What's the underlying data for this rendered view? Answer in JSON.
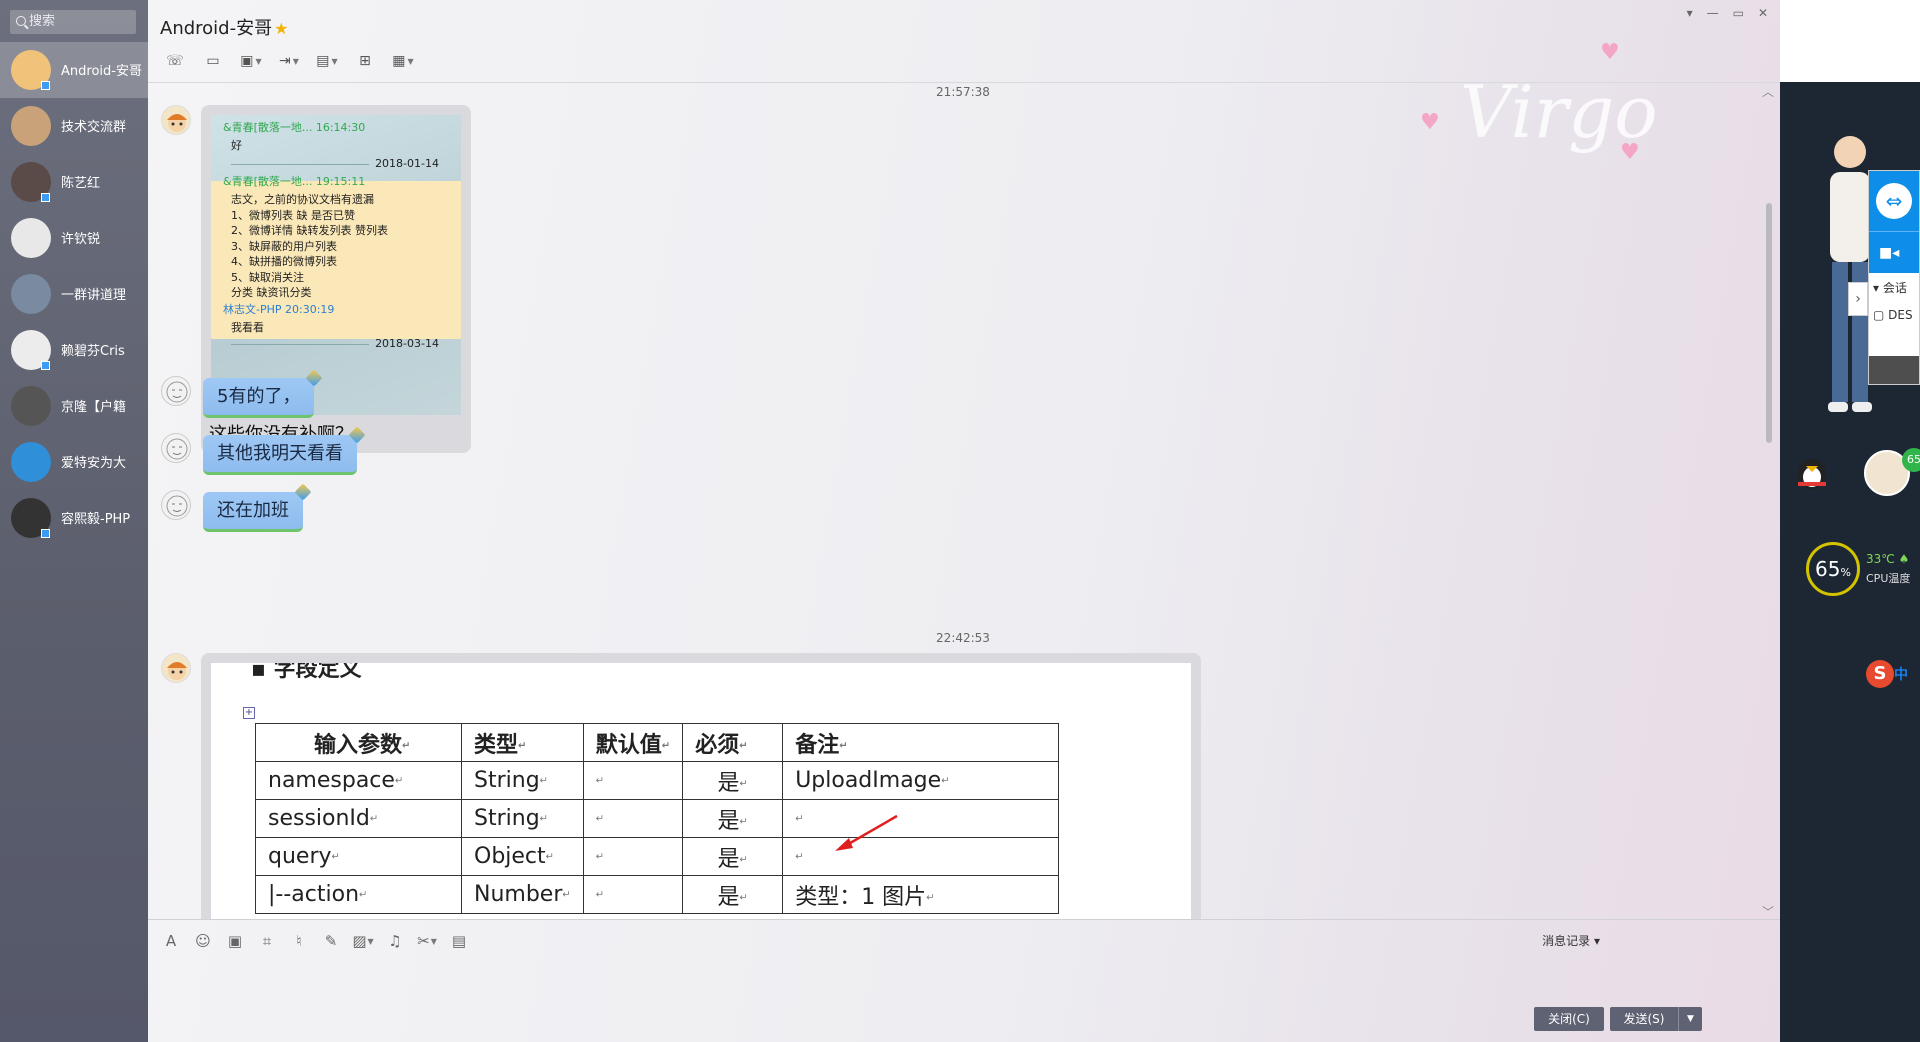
{
  "search": {
    "placeholder": "搜索"
  },
  "contacts": [
    {
      "name": "Android-安哥",
      "active": true
    },
    {
      "name": "技术交流群",
      "active": false
    },
    {
      "name": "陈艺红",
      "active": false
    },
    {
      "name": "许钦锐",
      "active": false
    },
    {
      "name": "一群讲道理",
      "active": false
    },
    {
      "name": "赖碧芬Cris",
      "active": false
    },
    {
      "name": "京隆【户籍",
      "active": false
    },
    {
      "name": "爱特安为大",
      "active": false
    },
    {
      "name": "容熙毅-PHP",
      "active": false
    }
  ],
  "header": {
    "title": "Android-安哥",
    "toolbar_icons": [
      "phone-icon",
      "video-icon",
      "screen-share-icon",
      "file-transfer-icon",
      "remote-desktop-icon",
      "new-chat-icon",
      "apps-icon"
    ]
  },
  "chat": {
    "timestamp_1": "21:57:38",
    "quote": {
      "lines": [
        {
          "text": "&青春[散落一地... 16:14:30",
          "kind": "sender"
        },
        {
          "text": "好",
          "kind": "body"
        },
        {
          "text": "2018-01-14",
          "kind": "date"
        },
        {
          "text": "&青春[散落一地... 19:15:11",
          "kind": "sender"
        },
        {
          "text": "志文，之前的协议文档有遗漏",
          "kind": "body"
        },
        {
          "text": "1、微博列表 缺 是否已赞",
          "kind": "body"
        },
        {
          "text": "2、微博详情 缺转发列表  赞列表",
          "kind": "body"
        },
        {
          "text": "3、缺屏蔽的用户列表",
          "kind": "body"
        },
        {
          "text": "4、缺拼播的微博列表",
          "kind": "body"
        },
        {
          "text": "5、缺取消关注",
          "kind": "body"
        },
        {
          "text": "分类 缺资讯分类",
          "kind": "body"
        },
        {
          "text": "林志文-PHP 20:30:19",
          "kind": "sender-blue"
        },
        {
          "text": "我看看",
          "kind": "body"
        },
        {
          "text": "2018-03-14",
          "kind": "date"
        }
      ],
      "caption": "这些你没有补啊？"
    },
    "replies": [
      "5有的了，",
      "其他我明天看看",
      "还在加班"
    ],
    "timestamp_2": "22:42:53",
    "doc": {
      "heading": "字段定义",
      "headers": [
        "输入参数",
        "类型",
        "默认值",
        "必须",
        "备注"
      ],
      "rows": [
        [
          "namespace",
          "String",
          "",
          "是",
          "UploadImage"
        ],
        [
          "sessionId",
          "String",
          "",
          "是",
          ""
        ],
        [
          "query",
          "Object",
          "",
          "是",
          ""
        ],
        [
          "|--action",
          "Number",
          "",
          "是",
          "类型：1 图片"
        ]
      ]
    }
  },
  "input": {
    "toolbar_icons": [
      "font-icon",
      "emoji-icon",
      "gif-icon",
      "screenshot-icon",
      "voice-icon",
      "pen-icon",
      "image-icon",
      "music-icon",
      "scissors-icon",
      "archive-icon"
    ],
    "history_label": "消息记录",
    "close_label": "关闭(C)",
    "send_label": "发送(S)"
  },
  "right_panel": {
    "teamviewer_label": "会话",
    "teamviewer_item": "DES",
    "cpu_percent": "65",
    "cpu_percent_unit": "%",
    "cpu_temp": "33℃",
    "cpu_label": "CPU温度",
    "qq_badge": "65",
    "ime_mode": "中"
  }
}
